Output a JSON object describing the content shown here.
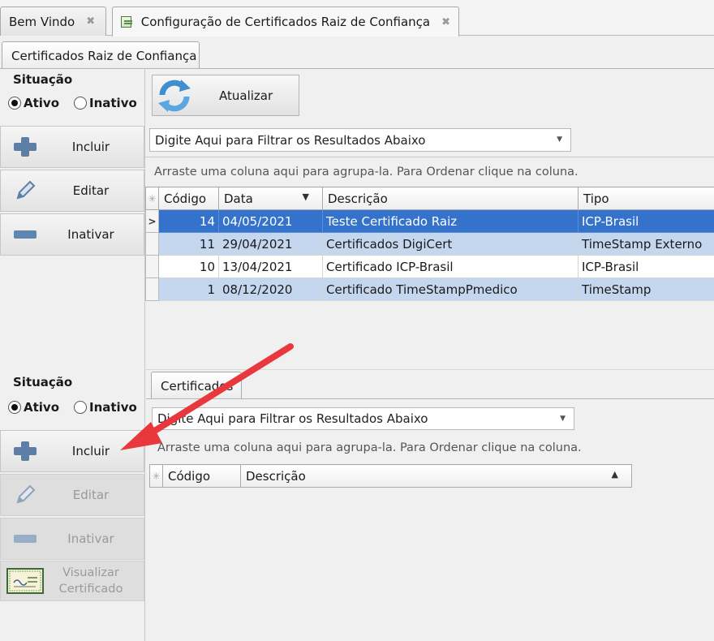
{
  "doc_tabs": [
    {
      "label": "Bem Vindo",
      "close": "✖"
    },
    {
      "label": "Configuração de Certificados Raiz de Confiança",
      "close": "✖"
    }
  ],
  "top": {
    "tab_label": "Certificados Raiz de Confiança",
    "situacao": {
      "title": "Situação",
      "ativo": "Ativo",
      "inativo": "Inativo",
      "selected": "Ativo"
    },
    "buttons": {
      "incluir": "Incluir",
      "editar": "Editar",
      "inativar": "Inativar",
      "atualizar": "Atualizar"
    },
    "filter_placeholder": "Digite Aqui para Filtrar os Resultados Abaixo",
    "group_hint": "Arraste uma coluna aqui para agrupa-la. Para Ordenar clique na coluna.",
    "columns": [
      "Código",
      "Data",
      "Descrição",
      "Tipo"
    ],
    "rows": [
      {
        "codigo": "14",
        "data": "04/05/2021",
        "descricao": "Teste Certificado Raiz",
        "tipo": "ICP-Brasil"
      },
      {
        "codigo": "11",
        "data": "29/04/2021",
        "descricao": "Certificados DigiCert",
        "tipo": "TimeStamp Externo"
      },
      {
        "codigo": "10",
        "data": "13/04/2021",
        "descricao": "Certificado ICP-Brasil",
        "tipo": "ICP-Brasil"
      },
      {
        "codigo": "1",
        "data": "08/12/2020",
        "descricao": "Certificado TimeStampPmedico",
        "tipo": "TimeStamp"
      }
    ]
  },
  "bottom": {
    "tab_label": "Certificados",
    "situacao": {
      "title": "Situação",
      "ativo": "Ativo",
      "inativo": "Inativo",
      "selected": "Ativo"
    },
    "buttons": {
      "incluir": "Incluir",
      "editar": "Editar",
      "inativar": "Inativar",
      "visualizar_1": "Visualizar",
      "visualizar_2": "Certificado"
    },
    "filter_placeholder": "Digite Aqui para Filtrar os Resultados Abaixo",
    "group_hint": "Arraste uma coluna aqui para agrupa-la. Para Ordenar clique na coluna.",
    "columns": [
      "Código",
      "Descrição"
    ]
  },
  "colors": {
    "selected_row": "#3472cc",
    "alt_row": "#c5d6ef",
    "annotation_arrow": "#e8383d"
  },
  "icons": {
    "refresh": "refresh-icon",
    "add": "plus-icon",
    "edit": "pencil-icon",
    "deactivate": "minus-icon",
    "certificate": "certificate-icon"
  }
}
